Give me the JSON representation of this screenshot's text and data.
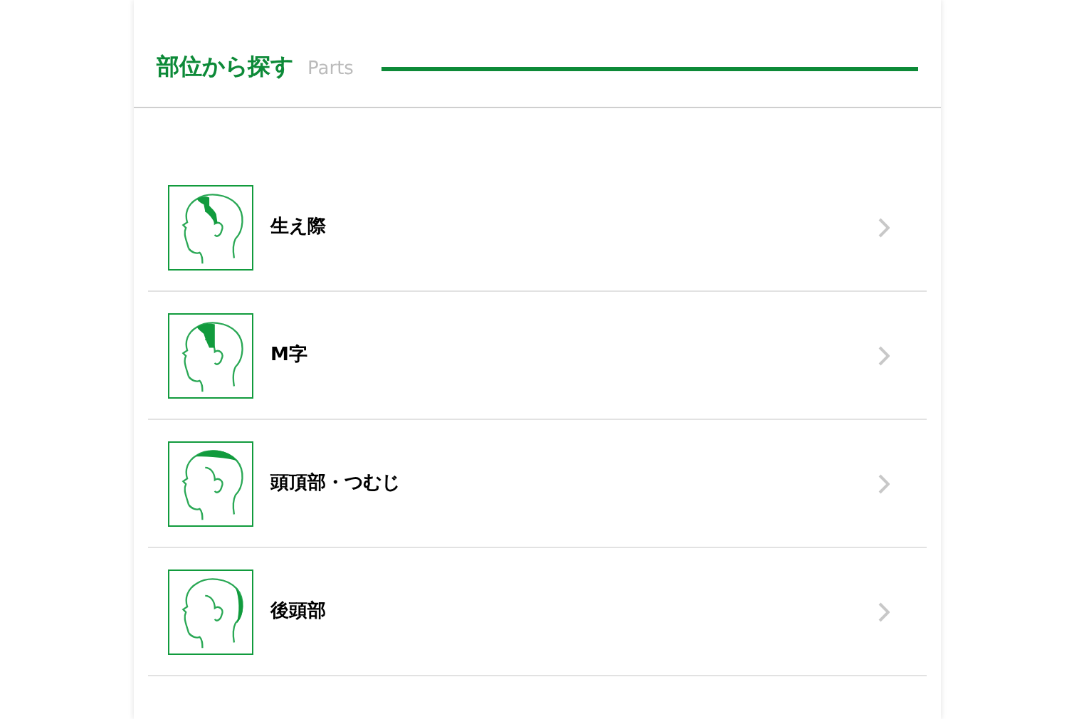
{
  "section": {
    "title": "部位から探す",
    "subtitle": "Parts"
  },
  "parts": [
    {
      "label": "生え際",
      "kind": "hairline"
    },
    {
      "label": "M字",
      "kind": "m"
    },
    {
      "label": "頭頂部・つむじ",
      "kind": "crown"
    },
    {
      "label": "後頭部",
      "kind": "back"
    }
  ]
}
